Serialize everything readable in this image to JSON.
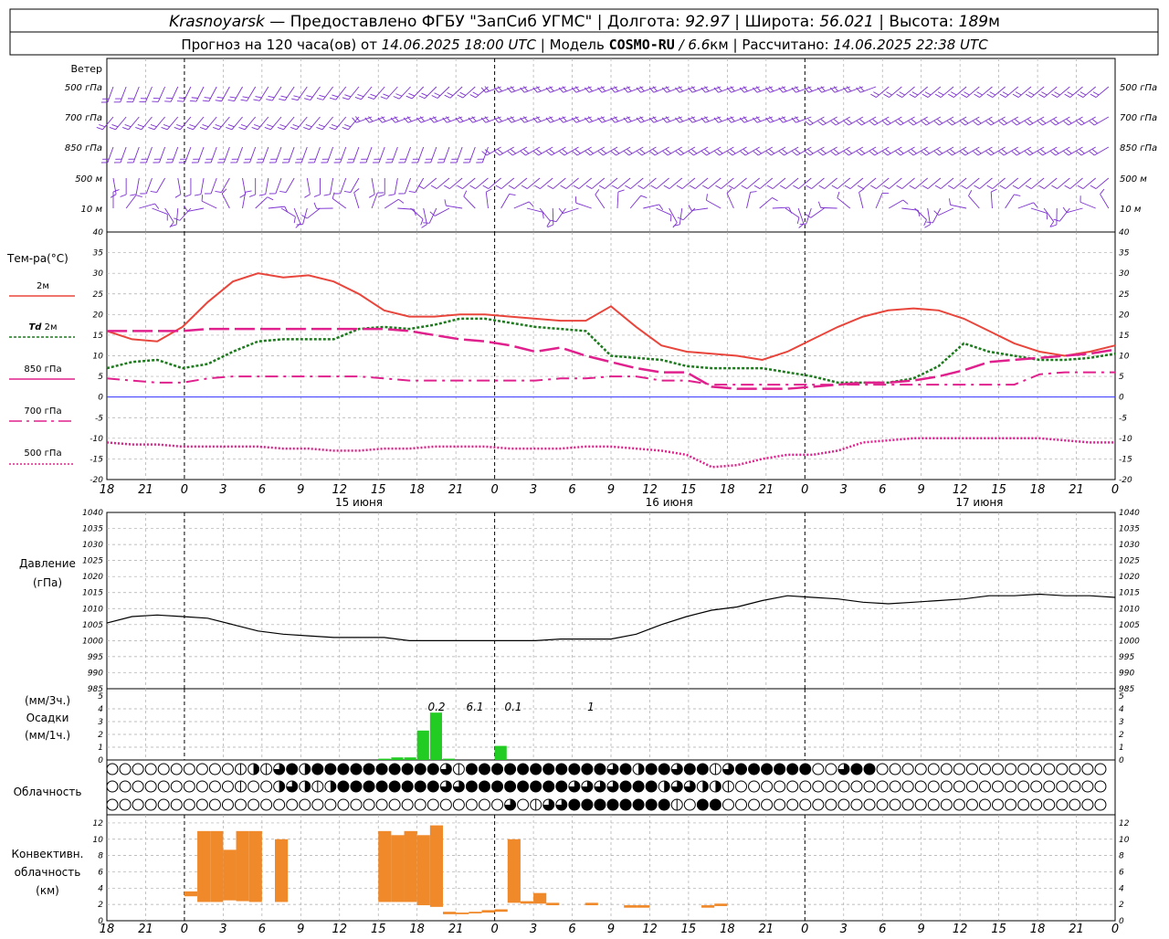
{
  "header": {
    "title": {
      "city": "Krasnoyarsk",
      "source": "— Предоставлено ФГБУ \"ЗапСиб УГМС\"",
      "lon_label": "Долгота:",
      "lon_value": "92.97",
      "lat_label": "Широта:",
      "lat_value": "56.021",
      "alt_label": "Высота:",
      "alt_value": "189",
      "alt_unit": "м"
    },
    "subtitle": {
      "forecast_label": "Прогноз на 120 часа(ов) от",
      "forecast_from": "14.06.2025 18:00 UTC",
      "model_label": "Модель",
      "model_name": "COSMO-RU",
      "model_res": "/ 6.6",
      "model_res_unit": "км",
      "calc_label": "Рассчитано:",
      "calc_value": "14.06.2025 22:38 UTC"
    }
  },
  "axis": {
    "hour_labels": [
      "18",
      "21",
      "0",
      "3",
      "6",
      "9",
      "12",
      "15",
      "18",
      "21",
      "0",
      "3",
      "6",
      "9",
      "12",
      "15",
      "18",
      "21",
      "0",
      "3",
      "6",
      "9",
      "12",
      "15",
      "18",
      "21",
      "0"
    ],
    "day_labels": [
      "15 июня",
      "16 июня",
      "17 июня"
    ],
    "midnights_idx": [
      2,
      10,
      18,
      26
    ]
  },
  "wind": {
    "title": "Ветер",
    "levels": [
      "500 гПа",
      "700 гПа",
      "850 гПа",
      "500 м",
      "10  м"
    ],
    "right_levels": [
      "500 гПа",
      "700 гПа",
      "850 гПа",
      "500 м",
      "10  м"
    ],
    "color": "#7b2fd0"
  },
  "temperature": {
    "title": "Тем-ра(°C)",
    "legend": {
      "t2m": "2м",
      "td_prefix": "Td",
      "td": "2м",
      "t850": "850 гПа",
      "t700": "700 гПа",
      "t500": "500 гПа"
    },
    "yticks": [
      "40",
      "35",
      "30",
      "25",
      "20",
      "15",
      "10",
      "5",
      "0",
      "-5",
      "-10",
      "-15",
      "-20"
    ],
    "colors": {
      "t2m": "#e8463c",
      "td": "#1d7a1d",
      "t850": "#e0208c",
      "t700": "#e0208c",
      "t500": "#e0208c",
      "zero": "#3030ff"
    }
  },
  "pressure": {
    "title1": "Давление",
    "title2": "(гПа)",
    "yticks": [
      "1040",
      "1035",
      "1030",
      "1025",
      "1020",
      "1015",
      "1010",
      "1005",
      "1000",
      "995",
      "990",
      "985"
    ]
  },
  "precip": {
    "title1": "(мм/3ч.)",
    "title2": "Осадки",
    "title3": "(мм/1ч.)",
    "yticks": [
      "5",
      "4",
      "3",
      "2",
      "1",
      "0"
    ],
    "annotations": [
      "0.2",
      "6.1",
      "0.1",
      "1"
    ],
    "color": "#22cc22"
  },
  "clouds": {
    "title": "Облачность"
  },
  "convective": {
    "title1": "Конвективн.",
    "title2": "облачность",
    "title3": "(км)",
    "yticks": [
      "12",
      "10",
      "8",
      "6",
      "4",
      "2",
      "0"
    ],
    "color": "#f0892a"
  },
  "chart_data": {
    "type": "line",
    "x_hours_from_start": [
      0,
      3,
      6,
      9,
      12,
      15,
      18,
      21,
      24,
      27,
      30,
      33,
      36,
      39,
      42,
      45,
      48,
      51,
      54,
      57,
      60,
      63,
      66,
      69,
      72,
      75,
      78,
      81,
      84,
      87,
      90,
      93,
      96,
      99,
      102,
      105,
      108,
      111,
      114,
      117,
      120
    ],
    "x_start": "14.06.2025 18:00 UTC",
    "series": [
      {
        "name": "2м",
        "values": [
          16,
          14,
          13.5,
          17,
          23,
          28,
          30,
          29,
          29.5,
          28,
          25,
          21,
          19.5,
          19.5,
          20,
          20,
          19.5,
          19,
          18.5,
          18.5,
          22,
          17,
          12.5,
          11,
          10.5,
          10,
          9,
          11,
          14,
          17,
          19.5,
          21,
          21.5,
          21,
          19,
          16,
          13,
          11,
          10,
          11,
          12.5
        ]
      },
      {
        "name": "Td 2м",
        "values": [
          7,
          8.5,
          9,
          7,
          8,
          11,
          13.5,
          14,
          14,
          14,
          16.5,
          17,
          16.5,
          17.5,
          19,
          19,
          18,
          17,
          16.5,
          16,
          10,
          9.5,
          9,
          7.5,
          7,
          7,
          7,
          6,
          5,
          3.5,
          3.5,
          3.5,
          4.5,
          7.5,
          13,
          11,
          10,
          9,
          9,
          9.5,
          10.5
        ]
      },
      {
        "name": "850 гПа",
        "values": [
          16,
          16,
          16,
          16,
          16.5,
          16.5,
          16.5,
          16.5,
          16.5,
          16.5,
          16.5,
          16.5,
          16,
          15,
          14,
          13.5,
          12.5,
          11,
          12,
          10,
          8.5,
          7,
          6,
          6,
          2.5,
          2,
          2,
          2,
          2.5,
          3,
          3.5,
          3.5,
          4,
          5,
          6.5,
          8.5,
          9,
          9.5,
          10,
          10.5,
          11.5
        ]
      },
      {
        "name": "700 гПа",
        "values": [
          4.5,
          4,
          3.5,
          3.5,
          4.5,
          5,
          5,
          5,
          5,
          5,
          5,
          4.5,
          4,
          4,
          4,
          4,
          4,
          4,
          4.5,
          4.5,
          5,
          5,
          4,
          4,
          3,
          3,
          3,
          3,
          3,
          3,
          3,
          3,
          3,
          3,
          3,
          3,
          3,
          5.5,
          6,
          6,
          6
        ]
      },
      {
        "name": "500 гПа",
        "values": [
          -11,
          -11.5,
          -11.5,
          -12,
          -12,
          -12,
          -12,
          -12.5,
          -12.5,
          -13,
          -13,
          -12.5,
          -12.5,
          -12,
          -12,
          -12,
          -12.5,
          -12.5,
          -12.5,
          -12,
          -12,
          -12.5,
          -13,
          -14,
          -17,
          -16.5,
          -15,
          -14,
          -14,
          -13,
          -11,
          -10.5,
          -10,
          -10,
          -10,
          -10,
          -10,
          -10,
          -10.5,
          -11,
          -11
        ]
      },
      {
        "name": "Давление",
        "values": [
          1005.5,
          1007.5,
          1008,
          1007.5,
          1007,
          1005,
          1003,
          1002,
          1001.5,
          1001,
          1001,
          1001,
          1000,
          1000,
          1000,
          1000,
          1000,
          1000,
          1000.5,
          1000.5,
          1000.5,
          1002,
          1005,
          1007.5,
          1009.5,
          1010.5,
          1012.5,
          1014,
          1013.5,
          1013,
          1012,
          1011.5,
          1012,
          1012.5,
          1013,
          1014,
          1014,
          1014.5,
          1014,
          1014,
          1013.5
        ]
      }
    ],
    "precip_bars": [
      {
        "h": 21,
        "mm": 0.1
      },
      {
        "h": 22,
        "mm": 0.2
      },
      {
        "h": 23,
        "mm": 0.2
      },
      {
        "h": 24,
        "mm": 2.3
      },
      {
        "h": 25,
        "mm": 3.7
      },
      {
        "h": 26,
        "mm": 0.1
      },
      {
        "h": 30,
        "mm": 1.1
      }
    ],
    "convective_bars": [
      {
        "h": 6,
        "lo": 3,
        "hi": 3.6
      },
      {
        "h": 7,
        "lo": 2.3,
        "hi": 11
      },
      {
        "h": 8,
        "lo": 2.3,
        "hi": 11
      },
      {
        "h": 9,
        "lo": 2.5,
        "hi": 8.7
      },
      {
        "h": 10,
        "lo": 2.4,
        "hi": 11
      },
      {
        "h": 11,
        "lo": 2.3,
        "hi": 11
      },
      {
        "h": 13,
        "lo": 2.3,
        "hi": 10
      },
      {
        "h": 21,
        "lo": 2.3,
        "hi": 11
      },
      {
        "h": 22,
        "lo": 2.3,
        "hi": 10.5
      },
      {
        "h": 23,
        "lo": 2.3,
        "hi": 11
      },
      {
        "h": 24,
        "lo": 1.9,
        "hi": 10.5
      },
      {
        "h": 25,
        "lo": 1.7,
        "hi": 11.7
      },
      {
        "h": 26,
        "lo": 0.8,
        "hi": 1.1
      },
      {
        "h": 27,
        "lo": 0.8,
        "hi": 1
      },
      {
        "h": 28,
        "lo": 0.9,
        "hi": 1.1
      },
      {
        "h": 29,
        "lo": 1,
        "hi": 1.3
      },
      {
        "h": 30,
        "lo": 1.1,
        "hi": 1.4
      },
      {
        "h": 31,
        "lo": 2.2,
        "hi": 10
      },
      {
        "h": 32,
        "lo": 2.1,
        "hi": 2.4
      },
      {
        "h": 33,
        "lo": 2.1,
        "hi": 3.4
      },
      {
        "h": 34,
        "lo": 1.9,
        "hi": 2.2
      },
      {
        "h": 37,
        "lo": 1.9,
        "hi": 2.2
      },
      {
        "h": 40,
        "lo": 1.6,
        "hi": 1.9
      },
      {
        "h": 41,
        "lo": 1.6,
        "hi": 1.9
      },
      {
        "h": 46,
        "lo": 1.6,
        "hi": 1.9
      },
      {
        "h": 47,
        "lo": 1.8,
        "hi": 2.1
      }
    ],
    "cloud_rows": [
      [
        0,
        0,
        0,
        0,
        0,
        0,
        0,
        0,
        0,
        0,
        1,
        2,
        1,
        3,
        4,
        2,
        4,
        4,
        4,
        4,
        4,
        4,
        4,
        4,
        4,
        4,
        3,
        1,
        4,
        4,
        4,
        4,
        4,
        4,
        4,
        4,
        4,
        4,
        4,
        3,
        4,
        2,
        4,
        4,
        3,
        4,
        4,
        1,
        3,
        4,
        4,
        4,
        4,
        4,
        4,
        0,
        0,
        3,
        4,
        4,
        0,
        0,
        0,
        0,
        0,
        0,
        0,
        0,
        0,
        0,
        0,
        0,
        0,
        0,
        0,
        0,
        0,
        0,
        0,
        0,
        0,
        0,
        0,
        0,
        0,
        0,
        0,
        0,
        3,
        1,
        3,
        0,
        0,
        0,
        2,
        0,
        0,
        0,
        0,
        1,
        2,
        3,
        3
      ],
      [
        0,
        0,
        0,
        0,
        0,
        0,
        0,
        0,
        0,
        0,
        1,
        0,
        0,
        2,
        3,
        2,
        1,
        2,
        4,
        4,
        4,
        4,
        4,
        4,
        4,
        4,
        3,
        3,
        4,
        4,
        4,
        4,
        4,
        4,
        4,
        4,
        3,
        3,
        3,
        3,
        4,
        4,
        4,
        2,
        3,
        3,
        2,
        2,
        1,
        0,
        0,
        0,
        0,
        0,
        0,
        0,
        0,
        0,
        0,
        0,
        0,
        0,
        0,
        0,
        0,
        0,
        0,
        0,
        0,
        0,
        0,
        0,
        0,
        0,
        0,
        0,
        0,
        0,
        0,
        0,
        0,
        0,
        0,
        0,
        0,
        0,
        0,
        0,
        0,
        0,
        1,
        2,
        2,
        4,
        4,
        0,
        0,
        0,
        0,
        0,
        0,
        0,
        0
      ],
      [
        0,
        0,
        0,
        0,
        0,
        0,
        0,
        0,
        0,
        0,
        0,
        0,
        0,
        0,
        0,
        0,
        0,
        0,
        0,
        0,
        0,
        0,
        0,
        0,
        0,
        0,
        0,
        0,
        0,
        0,
        0,
        3,
        0,
        1,
        3,
        3,
        4,
        4,
        4,
        4,
        4,
        4,
        4,
        4,
        1,
        0,
        4,
        4,
        0,
        0,
        0,
        0,
        0,
        0,
        0,
        0,
        0,
        0,
        0,
        0,
        0,
        0,
        0,
        0,
        0,
        0,
        0,
        0,
        0,
        0,
        0,
        0,
        0,
        0,
        0,
        0,
        0,
        0,
        0,
        0,
        0,
        0,
        0,
        0,
        0,
        0,
        0,
        0,
        0,
        1,
        0,
        0,
        0,
        0,
        0,
        0,
        0,
        0,
        0,
        0,
        0,
        0,
        0
      ]
    ],
    "ylim_temperature": [
      -20,
      40
    ],
    "ylim_pressure": [
      985,
      1040
    ],
    "ylim_precip": [
      0,
      5
    ],
    "ylim_convective": [
      0,
      13
    ],
    "grid": true
  }
}
